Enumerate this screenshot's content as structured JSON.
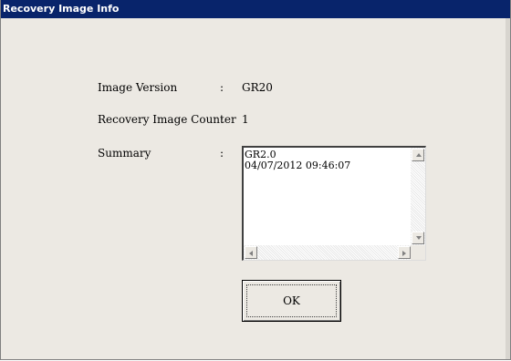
{
  "window": {
    "title": "Recovery Image Info"
  },
  "fields": {
    "image_version": {
      "label": "Image Version",
      "separator": ":",
      "value": "GR20"
    },
    "recovery_counter": {
      "label": "Recovery Image Counter",
      "separator": ":",
      "value": "1"
    },
    "summary": {
      "label": "Summary",
      "separator": ":",
      "lines": [
        "GR2.0",
        "04/07/2012 09:46:07"
      ]
    }
  },
  "buttons": {
    "ok_label": "OK"
  },
  "icons": {
    "scroll_up": "triangle-up-icon",
    "scroll_down": "triangle-down-icon",
    "scroll_left": "triangle-left-icon",
    "scroll_right": "triangle-right-icon"
  }
}
